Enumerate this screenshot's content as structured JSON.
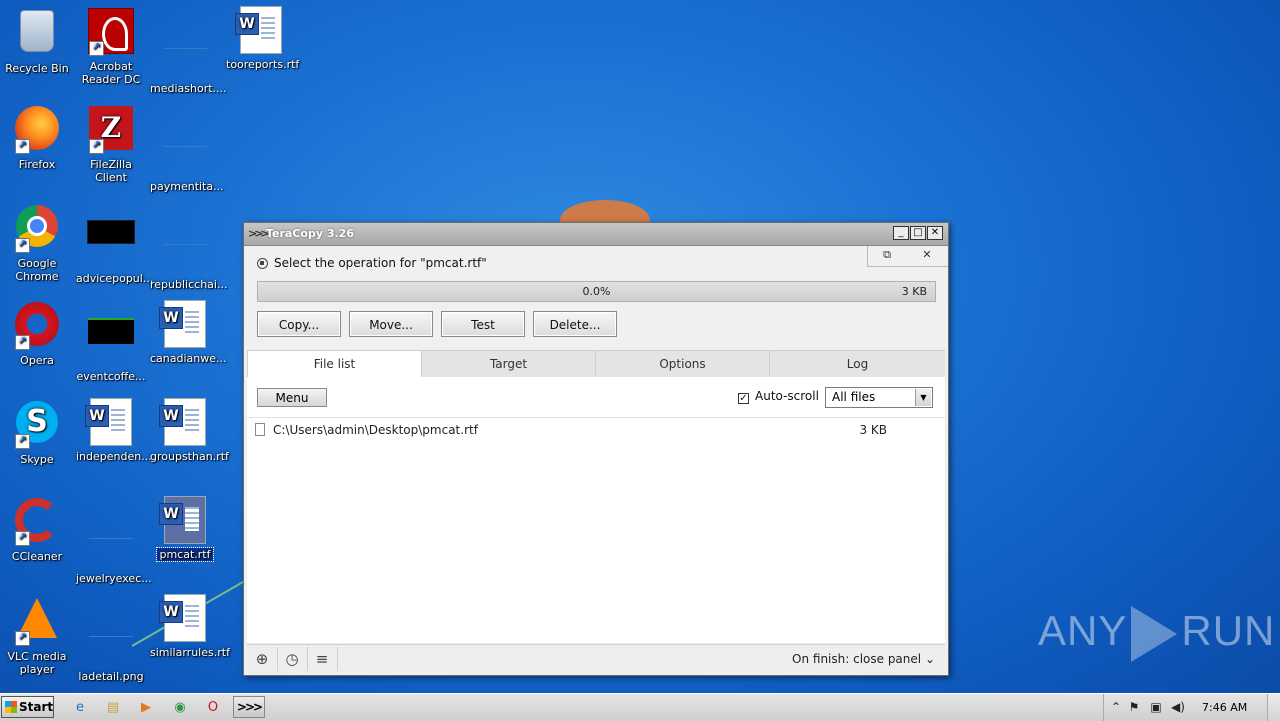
{
  "desktop": {
    "icons": [
      {
        "label": "Recycle Bin"
      },
      {
        "label": "Acrobat Reader DC"
      },
      {
        "label": "mediashort...."
      },
      {
        "label": "tooreports.rtf"
      },
      {
        "label": "Firefox"
      },
      {
        "label": "FileZilla Client"
      },
      {
        "label": "paymentita..."
      },
      {
        "label": "Google Chrome"
      },
      {
        "label": "advicepopul..."
      },
      {
        "label": "republicchai..."
      },
      {
        "label": "Opera"
      },
      {
        "label": "eventcoffe..."
      },
      {
        "label": "canadianwe..."
      },
      {
        "label": "Skype"
      },
      {
        "label": "independen..."
      },
      {
        "label": "groupsthan.rtf"
      },
      {
        "label": "CCleaner"
      },
      {
        "label": "jewelryexec..."
      },
      {
        "label": "pmcat.rtf"
      },
      {
        "label": "VLC media player"
      },
      {
        "label": "ladetail.png"
      },
      {
        "label": "similarrules.rtf"
      }
    ]
  },
  "teracopy": {
    "title": "TeraCopy 3.26",
    "operation_text": "Select the operation for \"pmcat.rtf\"",
    "progress_percent": "0.0%",
    "progress_fraction": 0.0,
    "progress_size": "3 KB",
    "buttons": {
      "copy": "Copy...",
      "move": "Move...",
      "test": "Test",
      "delete": "Delete..."
    },
    "tabs": [
      "File list",
      "Target",
      "Options",
      "Log"
    ],
    "active_tab": "File list",
    "menu_label": "Menu",
    "autoscroll_label": "Auto-scroll",
    "autoscroll_checked": true,
    "filter_value": "All files",
    "files": [
      {
        "path": "C:\\Users\\admin\\Desktop\\pmcat.rtf",
        "size": "3 KB"
      }
    ],
    "on_finish": "On finish: close panel"
  },
  "taskbar": {
    "start_label": "Start",
    "clock": "7:46 AM"
  },
  "watermark": {
    "left": "ANY",
    "right": "RUN"
  }
}
